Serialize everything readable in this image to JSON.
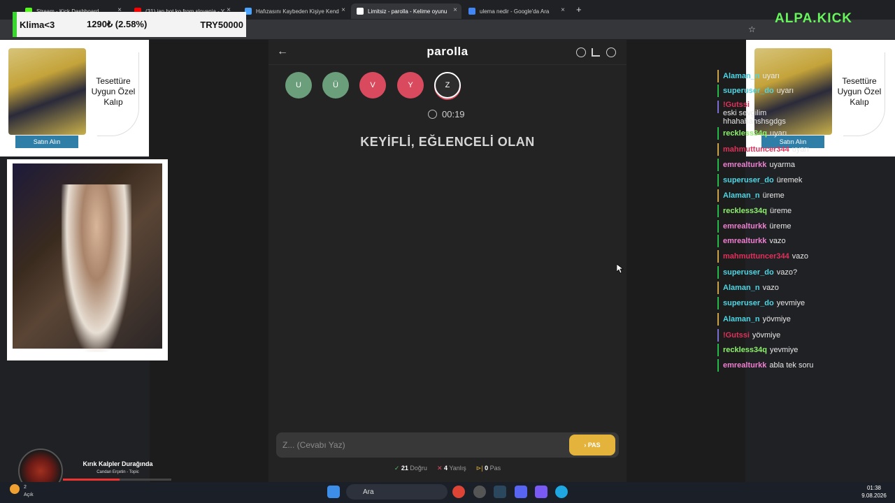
{
  "browser": {
    "tabs": [
      {
        "label": "Stream - Kick Dashboard",
        "color": "#53fc18"
      },
      {
        "label": "(31) ian hot ko from slovenia - Y",
        "color": "#ff0000"
      },
      {
        "label": "Hafızasını Kaybeden Kişiye Kend",
        "color": "#4aa3ff"
      },
      {
        "label": "Limitsiz - parolla - Kelime oyunu",
        "color": "#ffffff"
      },
      {
        "label": "ulema nedir - Google'da Ara",
        "color": "#4285f4"
      }
    ],
    "new_tab": "+"
  },
  "overlay": {
    "klima_label": "Klima<3",
    "price": "1290₺ (2.58%)",
    "goal": "TRY50000",
    "brand": "ALPA.KICK"
  },
  "game": {
    "title": "parolla",
    "letters": [
      {
        "char": "U",
        "color": "#6b9e7a"
      },
      {
        "char": "Ü",
        "color": "#6b9e7a"
      },
      {
        "char": "V",
        "color": "#d94a5e"
      },
      {
        "char": "Y",
        "color": "#d94a5e"
      },
      {
        "char": "Z",
        "color": "#2d2d2d"
      }
    ],
    "timer": "00:19",
    "clue": "KEYİFLİ, EĞLENCELİ OLAN",
    "input_placeholder": "Z... (Cevabı Yaz)",
    "pas_button": "PAS",
    "stats": {
      "correct_count": "21",
      "correct_label": "Doğru",
      "wrong_count": "4",
      "wrong_label": "Yanlış",
      "pass_count": "0",
      "pass_label": "Pas"
    }
  },
  "ad": {
    "text": "Tesettüre Uygun Özel Kalıp",
    "button": "Satın Alın"
  },
  "chat": [
    {
      "user": "Alaman_n",
      "msg": "uyarı",
      "color": "#4fd6e5",
      "border": "#c9a24a"
    },
    {
      "user": "superuser_do",
      "msg": "uyarı",
      "color": "#4fd6e5",
      "border": "#27b84a"
    },
    {
      "user": "!Gutssi",
      "msg": "eski sevgilim hhahahahshsgdgs",
      "color": "#e0315a",
      "border": "#7a6fd1"
    },
    {
      "user": "reckless34q",
      "msg": "uyarı",
      "color": "#8ef26d",
      "border": "#27b84a"
    },
    {
      "user": "mahmuttuncer344",
      "msg": "uyarı",
      "color": "#e0315a",
      "border": "#c9a24a"
    },
    {
      "user": "emrealturkk",
      "msg": "uyarma",
      "color": "#ee7fd1",
      "border": "#27b84a"
    },
    {
      "user": "superuser_do",
      "msg": "üremek",
      "color": "#4fd6e5",
      "border": "#27b84a"
    },
    {
      "user": "Alaman_n",
      "msg": "üreme",
      "color": "#4fd6e5",
      "border": "#c9a24a"
    },
    {
      "user": "reckless34q",
      "msg": "üreme",
      "color": "#8ef26d",
      "border": "#27b84a"
    },
    {
      "user": "emrealturkk",
      "msg": "üreme",
      "color": "#ee7fd1",
      "border": "#27b84a"
    },
    {
      "user": "emrealturkk",
      "msg": "vazo",
      "color": "#ee7fd1",
      "border": "#27b84a"
    },
    {
      "user": "mahmuttuncer344",
      "msg": "vazo",
      "color": "#e0315a",
      "border": "#c9a24a"
    },
    {
      "user": "superuser_do",
      "msg": "vazo?",
      "color": "#4fd6e5",
      "border": "#27b84a"
    },
    {
      "user": "Alaman_n",
      "msg": "vazo",
      "color": "#4fd6e5",
      "border": "#c9a24a"
    },
    {
      "user": "superuser_do",
      "msg": "yevmiye",
      "color": "#4fd6e5",
      "border": "#27b84a"
    },
    {
      "user": "Alaman_n",
      "msg": "yövmiye",
      "color": "#4fd6e5",
      "border": "#c9a24a"
    },
    {
      "user": "!Gutssi",
      "msg": "yövmiye",
      "color": "#e0315a",
      "border": "#7a6fd1"
    },
    {
      "user": "reckless34q",
      "msg": "yevmiye",
      "color": "#8ef26d",
      "border": "#27b84a"
    },
    {
      "user": "emrealturkk",
      "msg": "abla tek soru",
      "color": "#ee7fd1",
      "border": "#27b84a"
    }
  ],
  "music": {
    "song": "Kırık Kalpler Durağında",
    "artist": "Candan Erçetin - Topic",
    "progress": 0.52
  },
  "taskbar": {
    "search": "Ara",
    "weather_temp": "2",
    "weather_text": "Açık",
    "time": "01:38",
    "date": "9.08.2026"
  }
}
